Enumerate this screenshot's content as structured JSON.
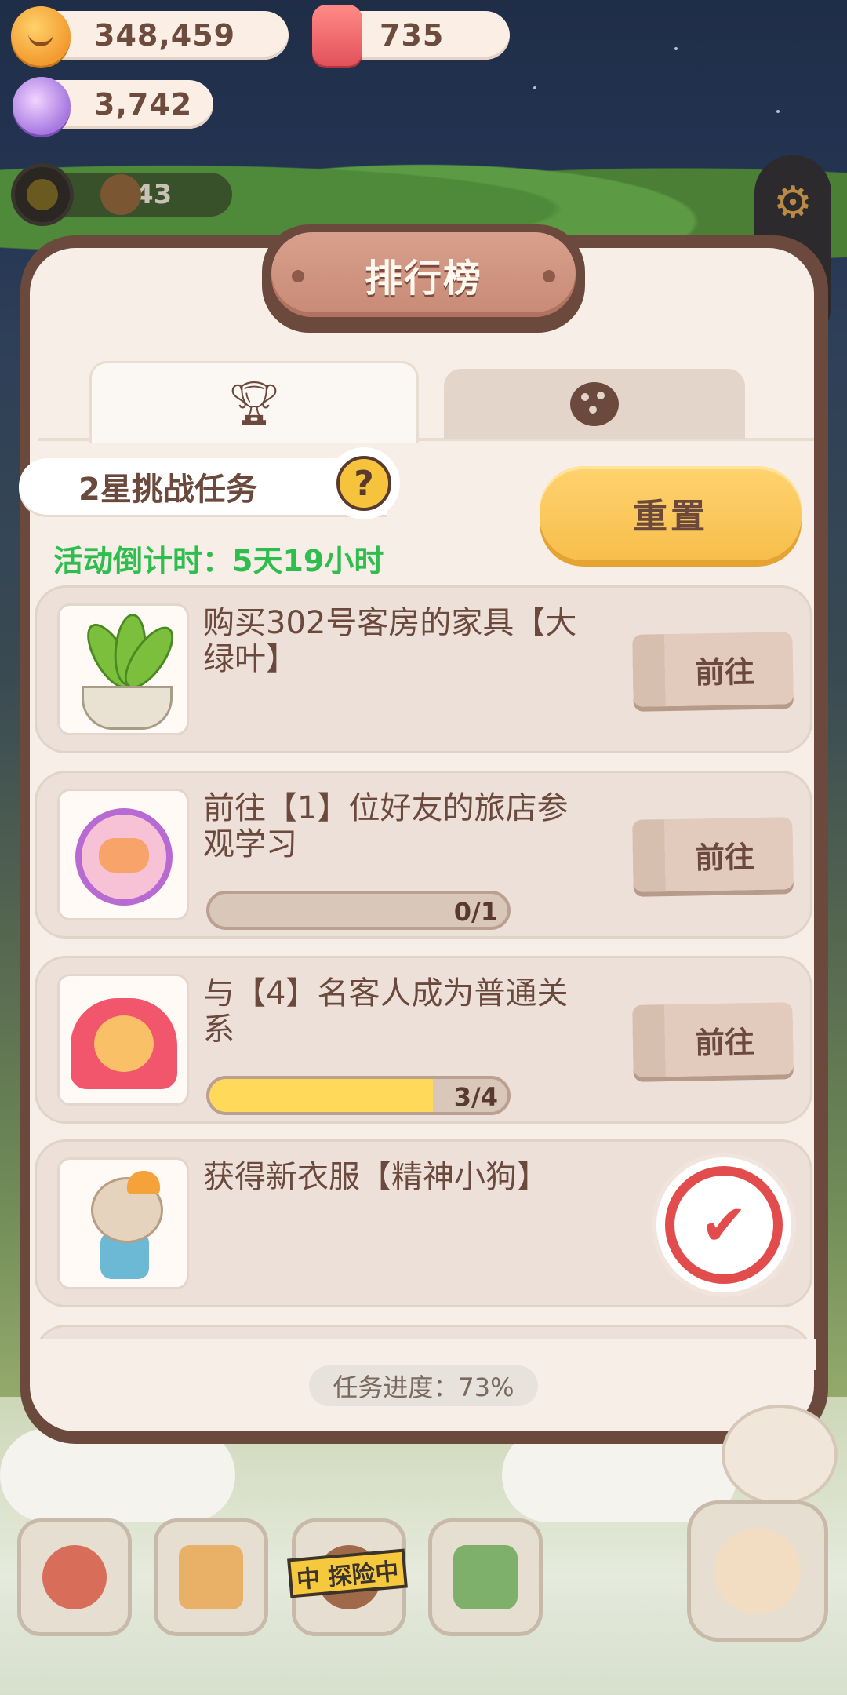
{
  "currencies": {
    "coins": "348,459",
    "candles": "735",
    "candy": "3,742"
  },
  "status": {
    "small_count": "43"
  },
  "panel": {
    "title": "排行榜",
    "tabs": [
      {
        "icon": "trophy-icon",
        "active": true
      },
      {
        "icon": "cookie-icon",
        "active": false
      }
    ],
    "challenge_label": "2星挑战任务",
    "help_label": "?",
    "reset_label": "重置",
    "countdown": "活动倒计时：5天19小时",
    "go_label": "前往",
    "tasks": [
      {
        "title": "购买302号客房的家具【大绿叶】",
        "thumb": "plant-icon",
        "has_progress": false
      },
      {
        "title": "前往【1】位好友的旅店参观学习",
        "thumb": "handshake-icon",
        "progress_text": "0/1",
        "progress_value": 0.0
      },
      {
        "title": "与【4】名客人成为普通关系",
        "thumb": "heart-cookie-icon",
        "progress_text": "3/4",
        "progress_value": 0.75
      },
      {
        "title": "获得新衣服【精神小狗】",
        "thumb": "character-outfit-icon",
        "completed": true
      }
    ],
    "total_progress": "任务进度：73%"
  },
  "bottom_nav": {
    "explore_tag": "中 探险中"
  },
  "colors": {
    "accent_yellow": "#f7be4c",
    "countdown_green": "#2fbe4e",
    "stamp_red": "#e24c4c",
    "panel_brown": "#6b4a3d"
  }
}
